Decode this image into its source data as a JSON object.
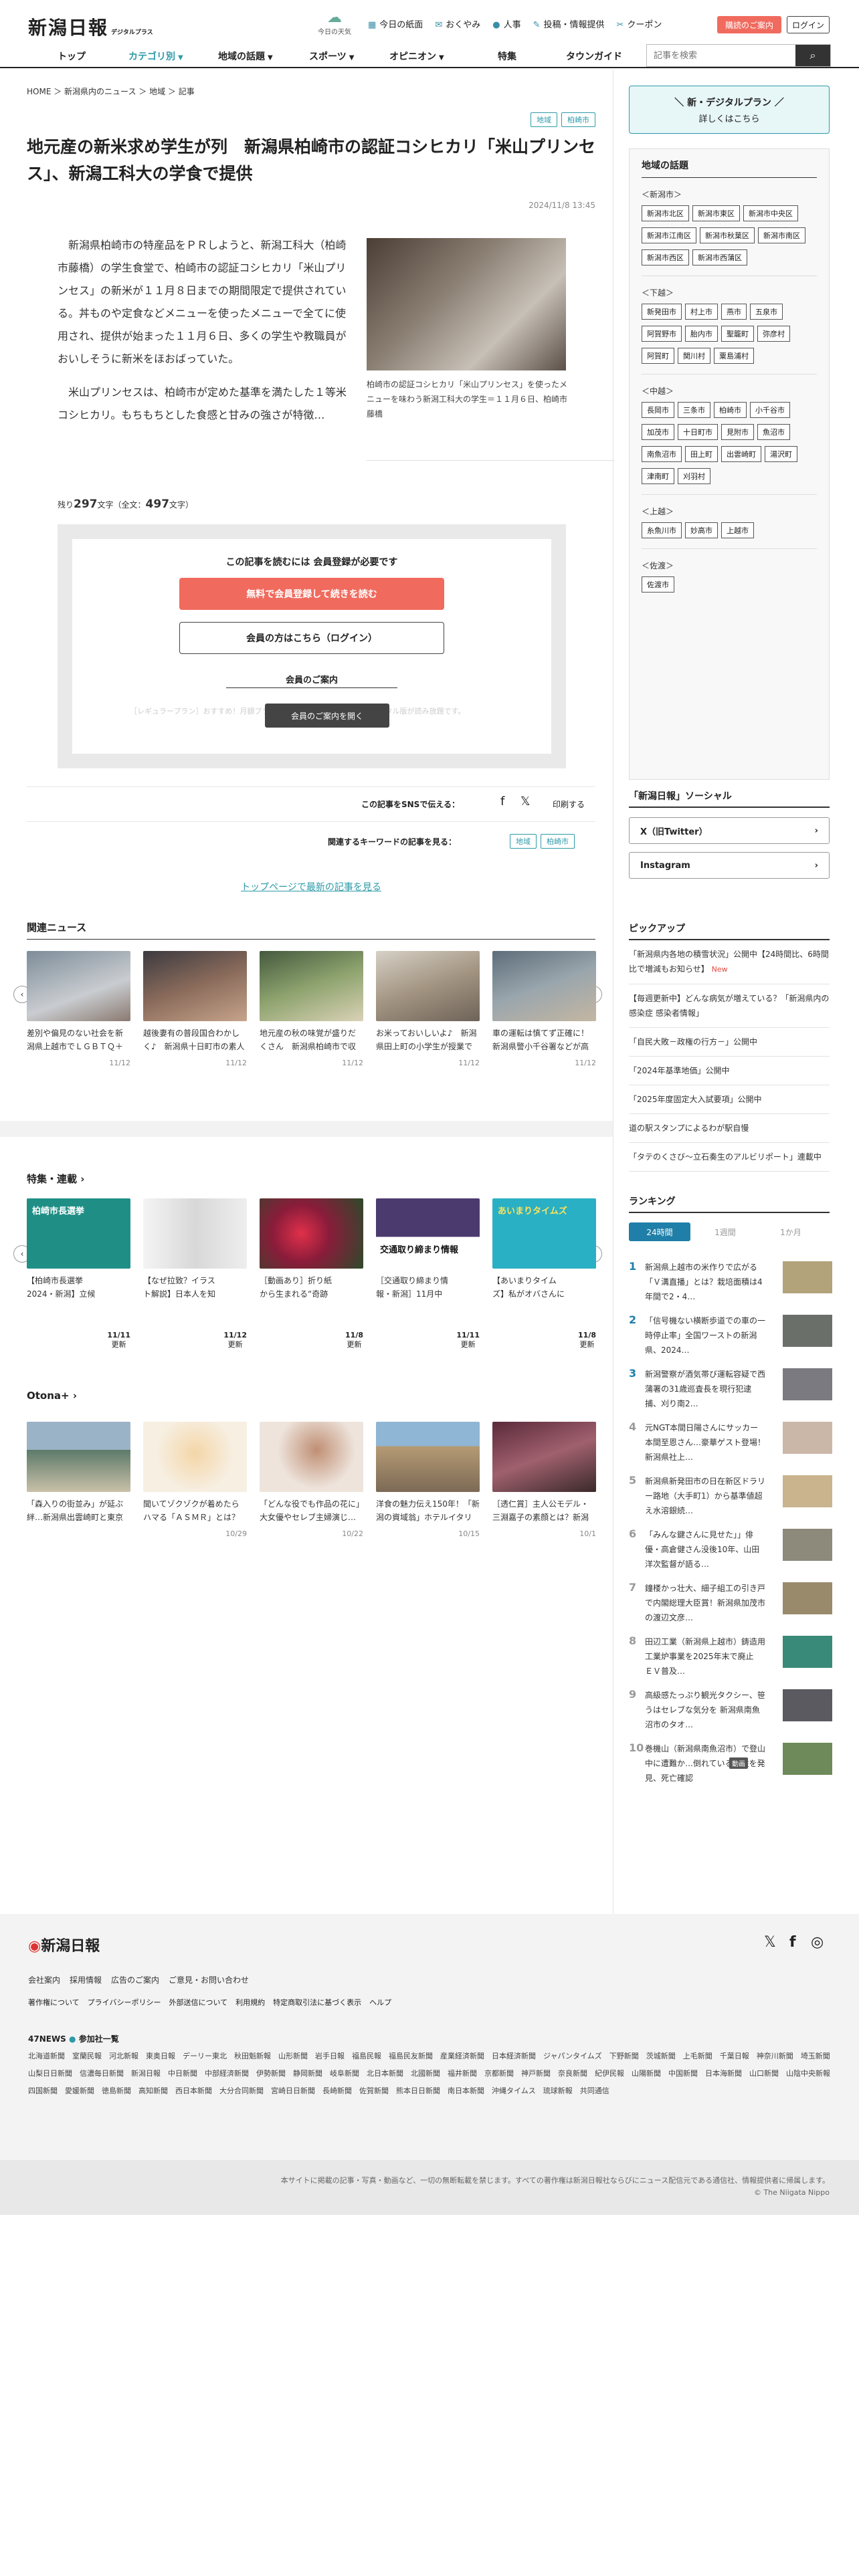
{
  "header": {
    "logo_text": "新潟日報",
    "logo_sub": "デジタルプラス",
    "weather_label": "今日の天気",
    "links": [
      {
        "icon": "newspaper-icon",
        "label": "今日の紙面"
      },
      {
        "icon": "bereavement-icon",
        "label": "おくやみ"
      },
      {
        "icon": "person-icon",
        "label": "人事"
      },
      {
        "icon": "post-icon",
        "label": "投稿・情報提供"
      },
      {
        "icon": "coupon-icon",
        "label": "クーポン"
      }
    ],
    "subscribe_label": "購読のご案内",
    "login_label": "ログイン"
  },
  "nav": {
    "items": [
      "トップ",
      "カテゴリ別",
      "地域の話題",
      "スポーツ",
      "オピニオン",
      "特集",
      "タウンガイド"
    ],
    "search_placeholder": "記事を検索"
  },
  "breadcrumb": [
    "HOME",
    "新潟県内のニュース",
    "地域",
    "記事"
  ],
  "article": {
    "tags": [
      "地域",
      "柏崎市"
    ],
    "title": "地元産の新米求め学生が列　新潟県柏崎市の認証コシヒカリ「米山プリンセス」、新潟工科大の学食で提供",
    "date": "2024/11/8 13:45",
    "para1": "新潟県柏崎市の特産品をＰＲしようと、新潟工科大（柏崎市藤橋）の学生食堂で、柏崎市の認証コシヒカリ「米山プリンセス」の新米が１１月８日までの期間限定で提供されている。丼ものや定食などメニューを使ったメニューで全てに使用され、提供が始まった１１月６日、多くの学生や教職員がおいしそうに新米をほおばっていた。",
    "para2": "米山プリンセスは、柏崎市が定めた基準を満たした１等米コシヒカリ。もちもちとした食感と甘みの強さが特徴…",
    "caption": "柏崎市の認証コシヒカリ「米山プリンセス」を使ったメニューを味わう新潟工科大の学生＝１１月６日、柏崎市藤橋",
    "remain_prefix": "残り",
    "remain_count": "297",
    "remain_mid": "文字（全文：",
    "total_count": "497",
    "remain_suffix": "文字）"
  },
  "paywall": {
    "heading": "この記事を読むには 会員登録が必要です",
    "register_label": "無料で会員登録して続きを読む",
    "login_label": "会員の方はこちら（ログイン）",
    "guide_heading": "会員のご案内",
    "guide_blur": "［レギュラープラン］おすすめ！月額プラン◎…すべての記事と新潟日報デジタル版が読み放題です。",
    "guide_button": "会員のご案内を開く"
  },
  "share": {
    "label": "この記事をSNSで伝える：",
    "print_label": "印刷する",
    "keywords_label": "関連するキーワードの記事を見る：",
    "keywords": [
      "地域",
      "柏崎市"
    ],
    "top_link": "トップページで最新の記事を見る"
  },
  "related": {
    "heading": "関連ニュース",
    "items": [
      {
        "text": "差別や偏見のない社会を新潟県上越市でＬＧＢＴＱ＋当事者らが…",
        "date": "11/12"
      },
      {
        "text": "越後妻有の普段国合わかしく♪　新潟県十日町市の素人劇団「かわ…",
        "date": "11/12"
      },
      {
        "text": "地元産の秋の味覚が盛りだくさん　新潟県柏崎市で収穫祭、お手頃…",
        "date": "11/12"
      },
      {
        "text": "お米っておいしいよ♪　新潟県田上町の小学生が授業で育てたコメ…",
        "date": "11/12"
      },
      {
        "text": "車の運転は慎てず正確に！　新潟県警小千谷署などが高齢者向けを…",
        "date": "11/12"
      }
    ]
  },
  "features": {
    "heading": "特集・連載",
    "items": [
      {
        "text": "【柏崎市長選挙2024・新潟】立候補者はどんな人？訴えや人柄…",
        "date": "11/11",
        "badge": "更新",
        "img_text": "柏崎市長選挙"
      },
      {
        "text": "【なぜ拉致？イラスト解説】日本人を知った目的は？北朝鮮はどん…",
        "date": "11/12",
        "badge": "更新",
        "img_text": ""
      },
      {
        "text": "［動画あり］折り紙から生まれる“奇跡のバラ”。その作り手は新…",
        "date": "11/8",
        "badge": "更新",
        "img_text": ""
      },
      {
        "text": "［交通取り締まり情報・新潟］11月中旬（11日〜20日）の「…",
        "date": "11/11",
        "badge": "更新",
        "img_text": "交通取り締まり情報"
      },
      {
        "text": "【あいまりタイムズ】私がオバさんになってもﾉ 激アツ「森高千…",
        "date": "11/8",
        "badge": "更新",
        "img_text": "あいまりタイムズ"
      }
    ]
  },
  "otona": {
    "heading": "Otona+",
    "items": [
      {
        "text": "「森入りの街並み」が延ぶ絆…新潟県出雲崎町と東京芸術大　町民…",
        "date": ""
      },
      {
        "text": "聞いてゾクゾクが着めたらハマる「ＡＳＭＲ」とは？　サクサク…",
        "date": "10/29"
      },
      {
        "text": "「どんな役でも作品の花に」大女優やセレブ主婦演じ…俳優・大山…",
        "date": "10/22"
      },
      {
        "text": "洋食の魅力伝え150年！「新潟の資域翁」ホテルイタリア軒　時…",
        "date": "10/15"
      },
      {
        "text": "［透仁賞］主人公モデル・三淵嘉子の素顔とは？新潟家庭で見せた…",
        "date": "10/1"
      }
    ]
  },
  "sidebar": {
    "plan_line1": "＼ 新・デジタルプラン ／",
    "plan_line2": "詳しくはこちら",
    "region_heading": "地域の話題",
    "groups": [
      {
        "label": "＜新潟市＞",
        "chips": [
          "新潟市北区",
          "新潟市東区",
          "新潟市中央区",
          "新潟市江南区",
          "新潟市秋葉区",
          "新潟市南区",
          "新潟市西区",
          "新潟市西蒲区"
        ]
      },
      {
        "label": "＜下越＞",
        "chips": [
          "新発田市",
          "村上市",
          "燕市",
          "五泉市",
          "阿賀野市",
          "胎内市",
          "聖籠町",
          "弥彦村",
          "阿賀町",
          "関川村",
          "粟島浦村"
        ]
      },
      {
        "label": "＜中越＞",
        "chips": [
          "長岡市",
          "三条市",
          "柏崎市",
          "小千谷市",
          "加茂市",
          "十日町市",
          "見附市",
          "魚沼市",
          "南魚沼市",
          "田上町",
          "出雲崎町",
          "湯沢町",
          "津南町",
          "刈羽村"
        ]
      },
      {
        "label": "＜上越＞",
        "chips": [
          "糸魚川市",
          "妙高市",
          "上越市"
        ]
      },
      {
        "label": "＜佐渡＞",
        "chips": [
          "佐渡市"
        ]
      }
    ],
    "social_heading": "「新潟日報」ソーシャル",
    "social_buttons": [
      "X（旧Twitter）",
      "Instagram"
    ],
    "pickup_heading": "ピックアップ",
    "pickup": [
      "「新潟県内各地の積雪状況」公開中【24時間比、6時間比で増減もお知らせ】",
      "【毎週更新中】どんな病気が増えている？「新潟県内の感染症 感染者情報」",
      "「自民大敗－政権の行方－」公開中",
      "「2024年基準地価」公開中",
      "「2025年度固定大入試要項」公開中",
      "道の駅スタンプによるわが駅自慢",
      "「タテのくさび〜立石奏生のアルビリポート」連載中"
    ],
    "pickup_new": "New",
    "ranking_heading": "ランキング",
    "ranking_tabs": [
      "24時間",
      "1週間",
      "1か月"
    ],
    "ranking": [
      "新潟県上越市の米作りで広がる「Ｖ溝直播」とは？栽培面積は4年間で2・4…",
      "「信号機ない横断歩道での車の一時停止率」全国ワーストの新潟県、2024…",
      "新潟警察が酒気帯び運転容疑で西蒲署の31歳巡査長を現行犯逮捕、刈り南2…",
      "元NGT本間日陽さんにサッカー本間至恩さん…豪華ゲスト登場！新潟県社上…",
      "新潟県新発田市の日在新区ドラリー路地（大手町1）から基準値超え水溶銀続…",
      "「みんな鍵さんに見せた」」俳優・高倉健さん没後10年、山田洋次監督が語る…",
      "鐘楼かっ壮大、細子組工の引き戸で内閣総理大臣賞！新潟県加茂市の渡辺文彦…",
      "田辺工業（新潟県上越市）鋳造用工業炉事業を2025年末で廃止　ＥＶ普及…",
      "高級感たっぷり観光タクシー、笹うはセレブな気分を 新潟県南魚沼市のタオ…",
      "巻機山（新潟県南魚沼市）で登山中に遭難か…倒れている男性を発見、死亡確認"
    ],
    "ranking_last_badge": "動画"
  },
  "footer": {
    "logo_text": "新潟日報",
    "links1": [
      "会社案内",
      "採用情報",
      "広告のご案内",
      "ご意見・お問い合わせ"
    ],
    "links2": [
      "著作権について",
      "プライバシーポリシー",
      "外部送信について",
      "利用規約",
      "特定商取引法に基づく表示",
      "ヘルプ"
    ],
    "news47_label": "47NEWS",
    "news47_sub": "参加社一覧",
    "members": "北海道新聞　室蘭民報　河北新報　東奥日報　デーリー東北　秋田魁新報　山形新聞　岩手日報　福島民報　福島民友新聞　産業経済新聞　日本経済新聞　ジャパンタイムズ　下野新聞　茨城新聞　上毛新聞　千葉日報　神奈川新聞　埼玉新聞　山梨日日新聞　信濃毎日新聞　新潟日報　中日新聞　中部経済新聞　伊勢新聞　静岡新聞　岐阜新聞　北日本新聞　北國新聞　福井新聞　京都新聞　神戸新聞　奈良新聞　紀伊民報　山陽新聞　中国新聞　日本海新聞　山口新聞　山陰中央新報　四国新聞　愛媛新聞　徳島新聞　高知新聞　西日本新聞　大分合同新聞　宮崎日日新聞　長崎新聞　佐賀新聞　熊本日日新聞　南日本新聞　沖縄タイムス　琉球新報　共同通信",
    "notice": "本サイトに掲載の記事・写真・動画など、一切の無断転載を禁じます。すべての著作権は新潟日報社ならびにニュース配信元である通信社、情報提供者に帰属します。",
    "copyright": "© The Niigata Nippo"
  },
  "colors": {
    "accent": "#2d9aa8",
    "red": "#f06b5e",
    "rank": "#1f7fa8"
  }
}
